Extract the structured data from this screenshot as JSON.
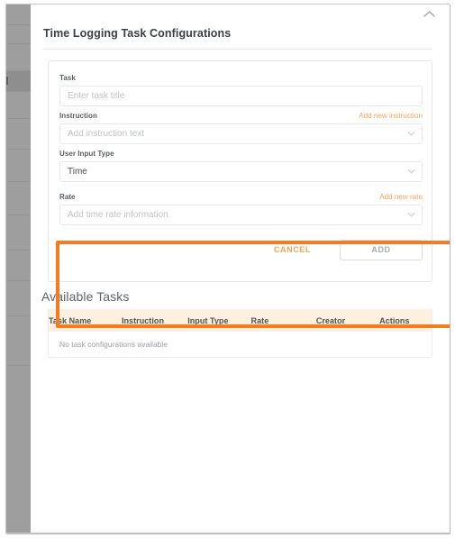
{
  "window": {
    "close_icon": "chevron-up-icon"
  },
  "background": {
    "sidebar_color": "#9e9e9e"
  },
  "modal": {
    "title": "Time Logging Task Configurations",
    "form": {
      "task": {
        "label": "Task",
        "placeholder": "Enter task title",
        "value": ""
      },
      "instruction": {
        "label": "Instruction",
        "action_link": "Add new instruction",
        "placeholder": "Add instruction text",
        "value": "",
        "dropdown_icon": "chevron-down-icon"
      },
      "user_input_type": {
        "label": "User Input Type",
        "value": "Time",
        "dropdown_icon": "chevron-down-icon"
      },
      "rate": {
        "label": "Rate",
        "action_link": "Add new rate",
        "placeholder": "Add time rate information",
        "value": "",
        "dropdown_icon": "chevron-down-icon"
      }
    },
    "buttons": {
      "cancel": "CANCEL",
      "add": "ADD"
    }
  },
  "available_tasks": {
    "title": "Available Tasks",
    "columns": [
      "Task Name",
      "Instruction",
      "Input Type",
      "Rate",
      "Creator",
      "Actions"
    ],
    "rows": [],
    "empty_message": "No task configurations available"
  },
  "colors": {
    "accent_orange": "#f47b20",
    "link_orange": "#f9a25a",
    "table_header_bg": "#fdf0de",
    "text_primary": "#3c4043",
    "text_muted": "#9aa0a5"
  }
}
